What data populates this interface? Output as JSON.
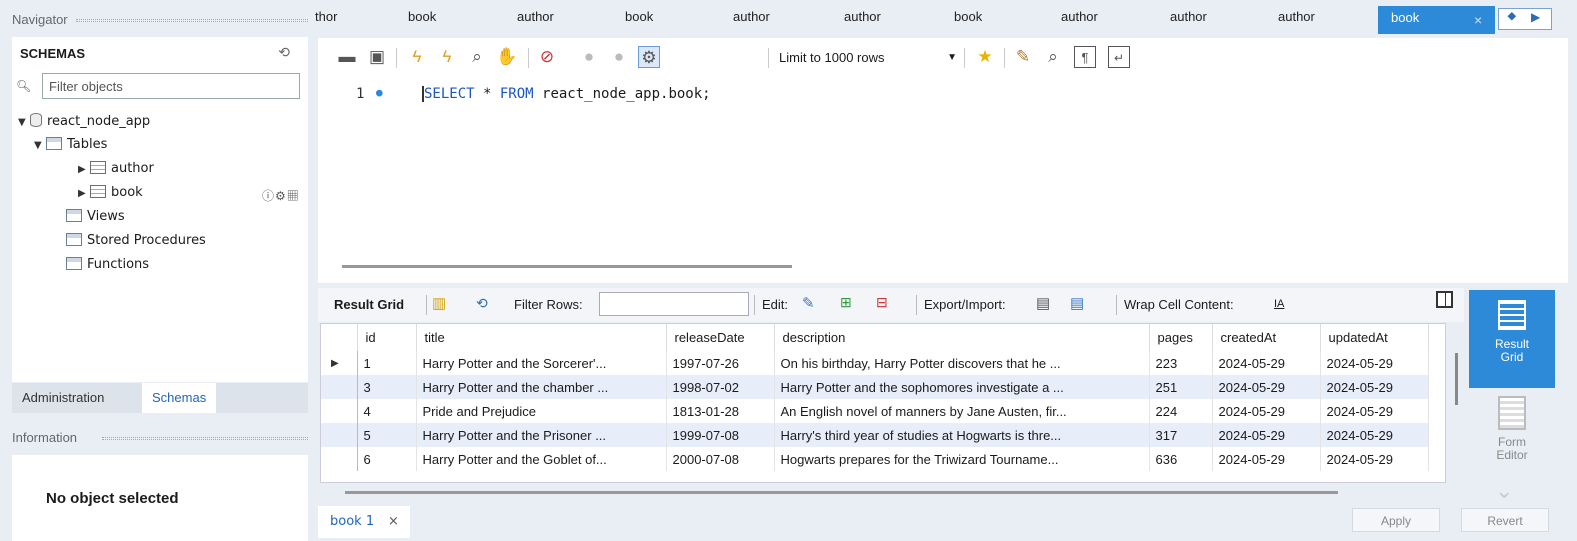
{
  "navigator": {
    "header": "Navigator",
    "schemas_title": "SCHEMAS",
    "filter_placeholder": "Filter objects",
    "tree": {
      "db": "react_node_app",
      "tables": "Tables",
      "author": "author",
      "book": "book",
      "views": "Views",
      "procedures": "Stored Procedures",
      "functions": "Functions"
    },
    "tabs": {
      "admin": "Administration",
      "schemas": "Schemas"
    },
    "info_header": "Information",
    "no_object": "No object selected"
  },
  "query_tabs": {
    "items": [
      "thor",
      "book",
      "author",
      "book",
      "author",
      "author",
      "book",
      "author",
      "author",
      "author"
    ],
    "active": "book",
    "close": "×"
  },
  "editor": {
    "limit_label": "Limit to 1000 rows",
    "line_number": "1",
    "sql_kw1": "SELECT",
    "sql_mid": " * ",
    "sql_kw2": "FROM",
    "sql_rest": " react_node_app.book;"
  },
  "result_toolbar": {
    "result_grid": "Result Grid",
    "filter_rows": "Filter Rows:",
    "edit": "Edit:",
    "export_import": "Export/Import:",
    "wrap": "Wrap Cell Content:"
  },
  "grid": {
    "columns": [
      "id",
      "title",
      "releaseDate",
      "description",
      "pages",
      "createdAt",
      "updatedAt"
    ],
    "rows": [
      [
        "1",
        "Harry Potter and the Sorcerer'...",
        "1997-07-26",
        "On his birthday, Harry Potter discovers that he ...",
        "223",
        "2024-05-29",
        "2024-05-29"
      ],
      [
        "3",
        "Harry Potter and the chamber ...",
        "1998-07-02",
        "Harry Potter and the sophomores investigate a ...",
        "251",
        "2024-05-29",
        "2024-05-29"
      ],
      [
        "4",
        "Pride and Prejudice",
        "1813-01-28",
        "An English novel of manners by Jane Austen, fir...",
        "224",
        "2024-05-29",
        "2024-05-29"
      ],
      [
        "5",
        "Harry Potter and the Prisoner ...",
        "1999-07-08",
        "Harry's third year of studies at Hogwarts is thre...",
        "317",
        "2024-05-29",
        "2024-05-29"
      ],
      [
        "6",
        "Harry Potter and the Goblet of...",
        "2000-07-08",
        "Hogwarts prepares for the Triwizard Tourname...",
        "636",
        "2024-05-29",
        "2024-05-29"
      ]
    ]
  },
  "side_panel": {
    "result_grid": "Result Grid",
    "form_editor": "Form Editor"
  },
  "bottom": {
    "result_tab": "book 1",
    "apply": "Apply",
    "revert": "Revert"
  },
  "colors": {
    "accent": "#2d8ad9",
    "keyword": "#1a55c4",
    "alt_row": "#e7eef9"
  }
}
